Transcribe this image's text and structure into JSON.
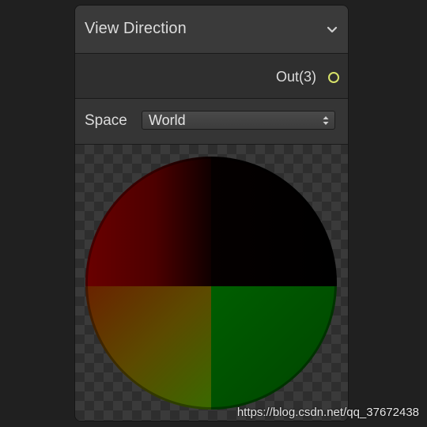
{
  "node": {
    "title": "View Direction",
    "collapse_icon": "chevron-down-icon"
  },
  "ports": {
    "output_label": "Out(3)",
    "output_color": "#d8e36a"
  },
  "settings": {
    "space_label": "Space",
    "space_value": "World",
    "dropdown_icon": "up-down-arrows-icon"
  },
  "preview": {
    "colors": {
      "top_left": "#7a0000",
      "top_right": "#000000",
      "bottom_left": "#7a7a00",
      "bottom_right": "#007a00"
    }
  },
  "watermark": "https://blog.csdn.net/qq_37672438"
}
